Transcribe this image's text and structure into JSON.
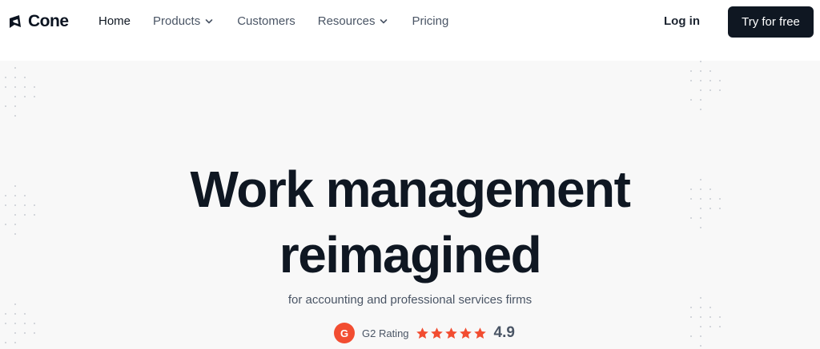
{
  "brand": {
    "name": "Cone"
  },
  "nav": {
    "home": "Home",
    "products": "Products",
    "customers": "Customers",
    "resources": "Resources",
    "pricing": "Pricing",
    "login": "Log in",
    "cta": "Try for free"
  },
  "hero": {
    "title_line1": "Work management",
    "title_line2": "reimagined",
    "subtitle": "for accounting and professional services firms"
  },
  "rating": {
    "badge": "G",
    "label": "G2 Rating",
    "stars": 5,
    "score": "4.9"
  },
  "colors": {
    "nav_bg": "#ffffff",
    "page_bg": "#f8f8f8",
    "cta_bg": "#0f1722",
    "g2_badge": "#f24d31",
    "star": "#f24d31"
  },
  "icons": {
    "logo": "cone-logo-icon",
    "chevron": "chevron-down-icon",
    "star": "star-icon"
  }
}
